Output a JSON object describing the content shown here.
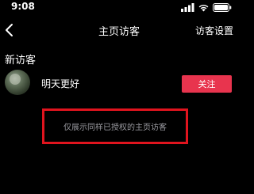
{
  "status_bar": {
    "time": "9:08",
    "icons": [
      "signal-icon",
      "wifi-icon",
      "battery-icon"
    ]
  },
  "nav": {
    "title": "主页访客",
    "right_link": "访客设置",
    "back_icon": "chevron-left-icon"
  },
  "section": {
    "heading": "新访客"
  },
  "visitors": [
    {
      "name": "明天更好",
      "button_label": "关注"
    }
  ],
  "notice": {
    "text": "仅展示同样已授权的主页访客"
  },
  "colors": {
    "background": "#000000",
    "accent": "#e8344e",
    "highlight_border": "#e0141e",
    "muted_text": "#9a9aa0"
  }
}
